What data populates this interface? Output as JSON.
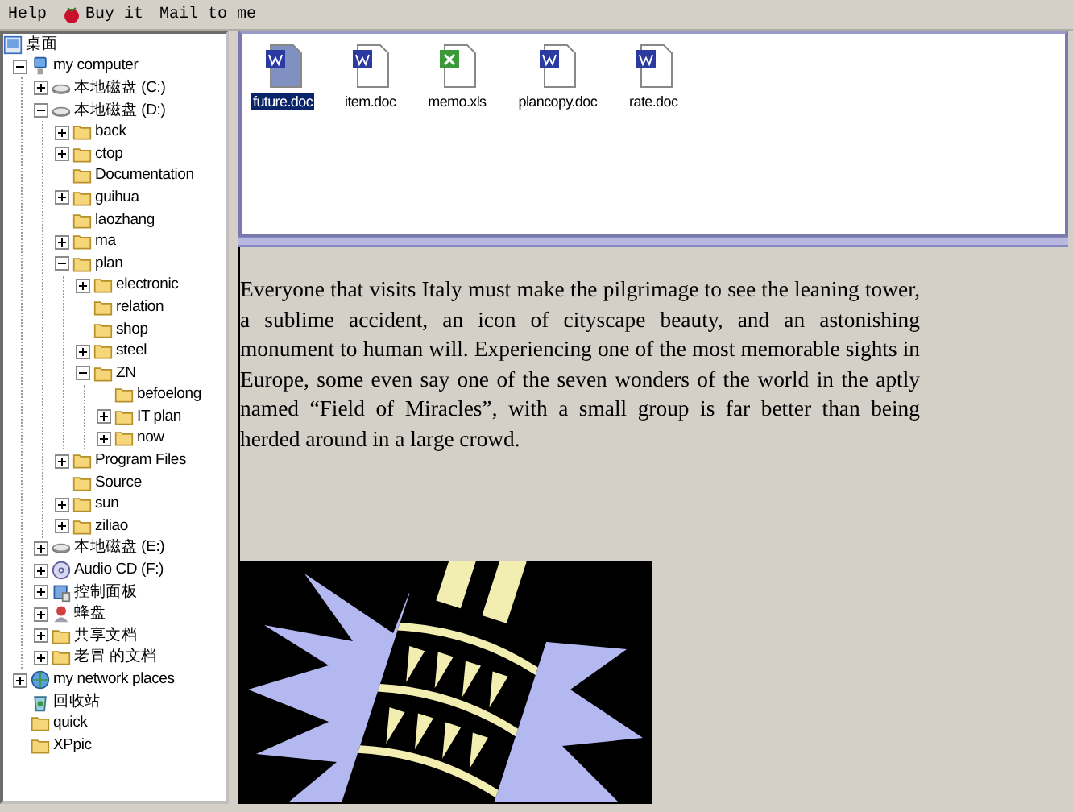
{
  "menu_bar": [
    {
      "label": "Help",
      "kind": "plain"
    },
    {
      "label": "Buy it",
      "kind": "icon"
    },
    {
      "label": "Mail to me",
      "kind": "plain"
    }
  ],
  "folder_tree": [
    {
      "label": "桌面",
      "kind": "desktop",
      "children": [
        {
          "label": "my computer",
          "kind": "computer",
          "expanded": true,
          "children": [
            {
              "label": "本地磁盘 (C:)",
              "kind": "drive",
              "expanded": false
            },
            {
              "label": "本地磁盘 (D:)",
              "kind": "drive",
              "expanded": true,
              "children": [
                {
                  "label": "back",
                  "kind": "folder",
                  "expanded": false
                },
                {
                  "label": "ctop",
                  "kind": "folder",
                  "expanded": false
                },
                {
                  "label": "Documentation",
                  "kind": "folder"
                },
                {
                  "label": "guihua",
                  "kind": "folder",
                  "expanded": false
                },
                {
                  "label": "laozhang",
                  "kind": "folder"
                },
                {
                  "label": "ma",
                  "kind": "folder",
                  "expanded": false
                },
                {
                  "label": "plan",
                  "kind": "folder",
                  "expanded": true,
                  "children": [
                    {
                      "label": "electronic",
                      "kind": "folder",
                      "expanded": false
                    },
                    {
                      "label": "relation",
                      "kind": "folder"
                    },
                    {
                      "label": "shop",
                      "kind": "folder"
                    },
                    {
                      "label": "steel",
                      "kind": "folder",
                      "expanded": false
                    },
                    {
                      "label": "ZN",
                      "kind": "folder",
                      "expanded": true,
                      "children": [
                        {
                          "label": "befoelong",
                          "kind": "folder"
                        },
                        {
                          "label": "IT plan",
                          "kind": "folder",
                          "expanded": false
                        },
                        {
                          "label": "now",
                          "kind": "folder",
                          "expanded": false
                        }
                      ]
                    }
                  ]
                },
                {
                  "label": "Program Files",
                  "kind": "folder",
                  "expanded": false
                },
                {
                  "label": "Source",
                  "kind": "folder"
                },
                {
                  "label": "sun",
                  "kind": "folder",
                  "expanded": false
                },
                {
                  "label": "ziliao",
                  "kind": "folder",
                  "expanded": false
                }
              ]
            },
            {
              "label": "本地磁盘 (E:)",
              "kind": "drive",
              "expanded": false
            },
            {
              "label": "Audio CD (F:)",
              "kind": "cd",
              "expanded": false
            },
            {
              "label": "控制面板",
              "kind": "control",
              "expanded": false
            },
            {
              "label": "蜂盘",
              "kind": "special",
              "expanded": false
            },
            {
              "label": "共享文档",
              "kind": "folder",
              "expanded": false
            },
            {
              "label": "老冒 的文档",
              "kind": "folder",
              "expanded": false
            }
          ]
        },
        {
          "label": "my network places",
          "kind": "network",
          "expanded": false
        },
        {
          "label": "回收站",
          "kind": "recycle"
        },
        {
          "label": "quick",
          "kind": "folder"
        },
        {
          "label": "XPpic",
          "kind": "folder"
        }
      ]
    }
  ],
  "files": [
    {
      "name": "future.doc",
      "kind": "doc",
      "selected": true
    },
    {
      "name": "item.doc",
      "kind": "doc",
      "selected": false
    },
    {
      "name": "memo.xls",
      "kind": "xls",
      "selected": false
    },
    {
      "name": "plancopy.doc",
      "kind": "doc",
      "selected": false
    },
    {
      "name": "rate.doc",
      "kind": "doc",
      "selected": false
    }
  ],
  "document": {
    "paragraph": "Everyone that visits Italy must make the pilgrimage to see the leaning tower, a sublime accident, an icon of cityscape beauty, and an astonishing monument to human will. Experiencing one of the most memorable sights in Europe, some even say one of the seven wonders of the world in the aptly named “Field of Miracles”, with a small group is far better than being herded around in a large crowd."
  }
}
